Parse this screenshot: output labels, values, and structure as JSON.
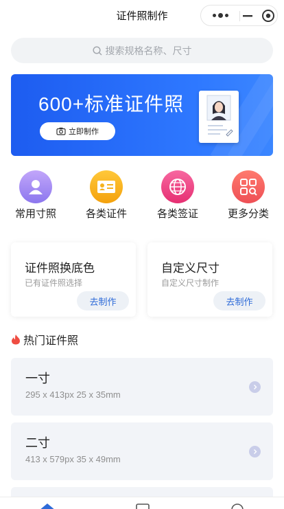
{
  "header": {
    "title": "证件照制作"
  },
  "search": {
    "placeholder": "搜索规格名称、尺寸"
  },
  "banner": {
    "title": "600+标准证件照",
    "button_label": "立即制作"
  },
  "categories": [
    {
      "label": "常用寸照",
      "icon": "person-icon",
      "color": "#a58cf4"
    },
    {
      "label": "各类证件",
      "icon": "id-card-icon",
      "color": "#f5b21e"
    },
    {
      "label": "各类签证",
      "icon": "globe-icon",
      "color": "#ef3f83"
    },
    {
      "label": "更多分类",
      "icon": "grid-icon",
      "color": "#f2605e"
    }
  ],
  "features": [
    {
      "title": "证件照换底色",
      "subtitle": "已有证件照选择",
      "button": "去制作"
    },
    {
      "title": "自定义尺寸",
      "subtitle": "自定义尺寸制作",
      "button": "去制作"
    }
  ],
  "hot": {
    "title": "热门证件照"
  },
  "photos": [
    {
      "name": "一寸",
      "spec": "295 x 413px  25 x 35mm"
    },
    {
      "name": "二寸",
      "spec": "413 x 579px  35 x 49mm"
    }
  ],
  "colors": {
    "accent": "#2e6bd8",
    "banner": "#1d5cf0",
    "card_bg": "#f2f4f8"
  }
}
